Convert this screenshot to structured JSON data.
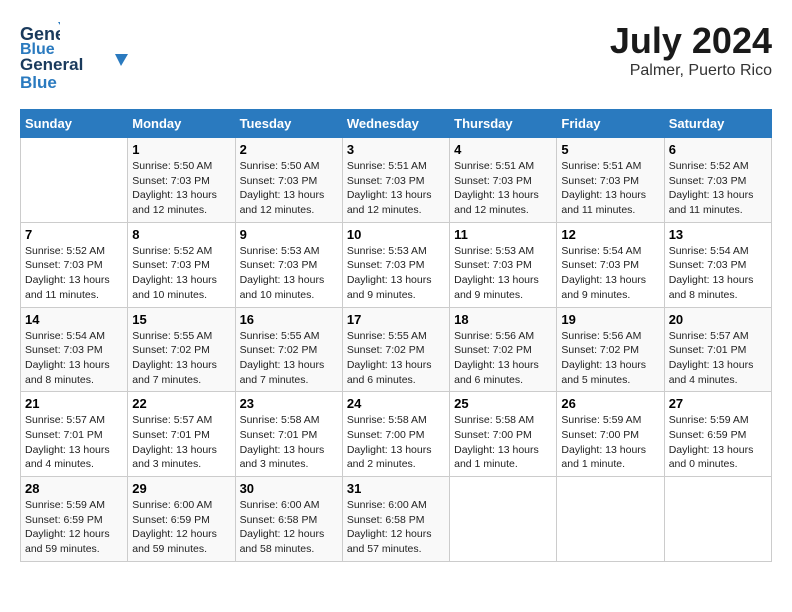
{
  "header": {
    "logo_line1": "General",
    "logo_line2": "Blue",
    "month": "July 2024",
    "location": "Palmer, Puerto Rico"
  },
  "days_of_week": [
    "Sunday",
    "Monday",
    "Tuesday",
    "Wednesday",
    "Thursday",
    "Friday",
    "Saturday"
  ],
  "weeks": [
    [
      {
        "day": null
      },
      {
        "day": "1",
        "sunrise": "5:50 AM",
        "sunset": "7:03 PM",
        "daylight": "13 hours and 12 minutes."
      },
      {
        "day": "2",
        "sunrise": "5:50 AM",
        "sunset": "7:03 PM",
        "daylight": "13 hours and 12 minutes."
      },
      {
        "day": "3",
        "sunrise": "5:51 AM",
        "sunset": "7:03 PM",
        "daylight": "13 hours and 12 minutes."
      },
      {
        "day": "4",
        "sunrise": "5:51 AM",
        "sunset": "7:03 PM",
        "daylight": "13 hours and 12 minutes."
      },
      {
        "day": "5",
        "sunrise": "5:51 AM",
        "sunset": "7:03 PM",
        "daylight": "13 hours and 11 minutes."
      },
      {
        "day": "6",
        "sunrise": "5:52 AM",
        "sunset": "7:03 PM",
        "daylight": "13 hours and 11 minutes."
      }
    ],
    [
      {
        "day": "7",
        "sunrise": "5:52 AM",
        "sunset": "7:03 PM",
        "daylight": "13 hours and 11 minutes."
      },
      {
        "day": "8",
        "sunrise": "5:52 AM",
        "sunset": "7:03 PM",
        "daylight": "13 hours and 10 minutes."
      },
      {
        "day": "9",
        "sunrise": "5:53 AM",
        "sunset": "7:03 PM",
        "daylight": "13 hours and 10 minutes."
      },
      {
        "day": "10",
        "sunrise": "5:53 AM",
        "sunset": "7:03 PM",
        "daylight": "13 hours and 9 minutes."
      },
      {
        "day": "11",
        "sunrise": "5:53 AM",
        "sunset": "7:03 PM",
        "daylight": "13 hours and 9 minutes."
      },
      {
        "day": "12",
        "sunrise": "5:54 AM",
        "sunset": "7:03 PM",
        "daylight": "13 hours and 9 minutes."
      },
      {
        "day": "13",
        "sunrise": "5:54 AM",
        "sunset": "7:03 PM",
        "daylight": "13 hours and 8 minutes."
      }
    ],
    [
      {
        "day": "14",
        "sunrise": "5:54 AM",
        "sunset": "7:03 PM",
        "daylight": "13 hours and 8 minutes."
      },
      {
        "day": "15",
        "sunrise": "5:55 AM",
        "sunset": "7:02 PM",
        "daylight": "13 hours and 7 minutes."
      },
      {
        "day": "16",
        "sunrise": "5:55 AM",
        "sunset": "7:02 PM",
        "daylight": "13 hours and 7 minutes."
      },
      {
        "day": "17",
        "sunrise": "5:55 AM",
        "sunset": "7:02 PM",
        "daylight": "13 hours and 6 minutes."
      },
      {
        "day": "18",
        "sunrise": "5:56 AM",
        "sunset": "7:02 PM",
        "daylight": "13 hours and 6 minutes."
      },
      {
        "day": "19",
        "sunrise": "5:56 AM",
        "sunset": "7:02 PM",
        "daylight": "13 hours and 5 minutes."
      },
      {
        "day": "20",
        "sunrise": "5:57 AM",
        "sunset": "7:01 PM",
        "daylight": "13 hours and 4 minutes."
      }
    ],
    [
      {
        "day": "21",
        "sunrise": "5:57 AM",
        "sunset": "7:01 PM",
        "daylight": "13 hours and 4 minutes."
      },
      {
        "day": "22",
        "sunrise": "5:57 AM",
        "sunset": "7:01 PM",
        "daylight": "13 hours and 3 minutes."
      },
      {
        "day": "23",
        "sunrise": "5:58 AM",
        "sunset": "7:01 PM",
        "daylight": "13 hours and 3 minutes."
      },
      {
        "day": "24",
        "sunrise": "5:58 AM",
        "sunset": "7:00 PM",
        "daylight": "13 hours and 2 minutes."
      },
      {
        "day": "25",
        "sunrise": "5:58 AM",
        "sunset": "7:00 PM",
        "daylight": "13 hours and 1 minute."
      },
      {
        "day": "26",
        "sunrise": "5:59 AM",
        "sunset": "7:00 PM",
        "daylight": "13 hours and 1 minute."
      },
      {
        "day": "27",
        "sunrise": "5:59 AM",
        "sunset": "6:59 PM",
        "daylight": "13 hours and 0 minutes."
      }
    ],
    [
      {
        "day": "28",
        "sunrise": "5:59 AM",
        "sunset": "6:59 PM",
        "daylight": "12 hours and 59 minutes."
      },
      {
        "day": "29",
        "sunrise": "6:00 AM",
        "sunset": "6:59 PM",
        "daylight": "12 hours and 59 minutes."
      },
      {
        "day": "30",
        "sunrise": "6:00 AM",
        "sunset": "6:58 PM",
        "daylight": "12 hours and 58 minutes."
      },
      {
        "day": "31",
        "sunrise": "6:00 AM",
        "sunset": "6:58 PM",
        "daylight": "12 hours and 57 minutes."
      },
      {
        "day": null
      },
      {
        "day": null
      },
      {
        "day": null
      }
    ]
  ]
}
